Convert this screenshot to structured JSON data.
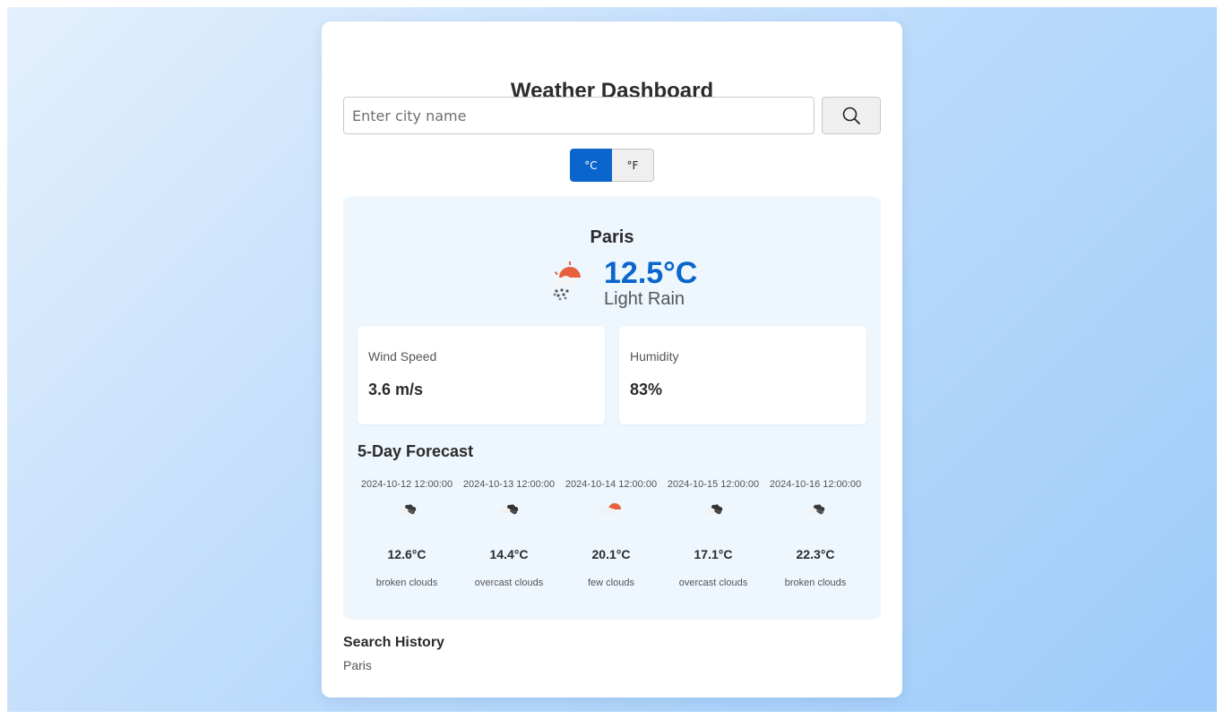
{
  "header": {
    "title": "Weather Dashboard"
  },
  "search": {
    "placeholder": "Enter city name",
    "value": "",
    "button_icon": "search-icon"
  },
  "units": {
    "celsius_label": "°C",
    "fahrenheit_label": "°F",
    "selected": "celsius"
  },
  "current": {
    "city": "Paris",
    "temperature": "12.5°C",
    "description": "Light Rain",
    "icon": "light-rain-icon",
    "wind_speed_label": "Wind Speed",
    "wind_speed_value": "3.6 m/s",
    "humidity_label": "Humidity",
    "humidity_value": "83%"
  },
  "forecast": {
    "title": "5-Day Forecast",
    "days": [
      {
        "date": "2024-10-12 12:00:00",
        "temp": "12.6°C",
        "desc": "broken clouds",
        "icon": "broken-clouds-icon"
      },
      {
        "date": "2024-10-13 12:00:00",
        "temp": "14.4°C",
        "desc": "overcast clouds",
        "icon": "overcast-clouds-icon"
      },
      {
        "date": "2024-10-14 12:00:00",
        "temp": "20.1°C",
        "desc": "few clouds",
        "icon": "few-clouds-icon"
      },
      {
        "date": "2024-10-15 12:00:00",
        "temp": "17.1°C",
        "desc": "overcast clouds",
        "icon": "overcast-clouds-icon"
      },
      {
        "date": "2024-10-16 12:00:00",
        "temp": "22.3°C",
        "desc": "broken clouds",
        "icon": "broken-clouds-icon"
      }
    ]
  },
  "history": {
    "title": "Search History",
    "items": [
      "Paris"
    ]
  },
  "colors": {
    "accent": "#0a66cc",
    "panel_bg": "#eef6fe",
    "sun": "#e8603c",
    "cloud": "#3a3a3a"
  }
}
